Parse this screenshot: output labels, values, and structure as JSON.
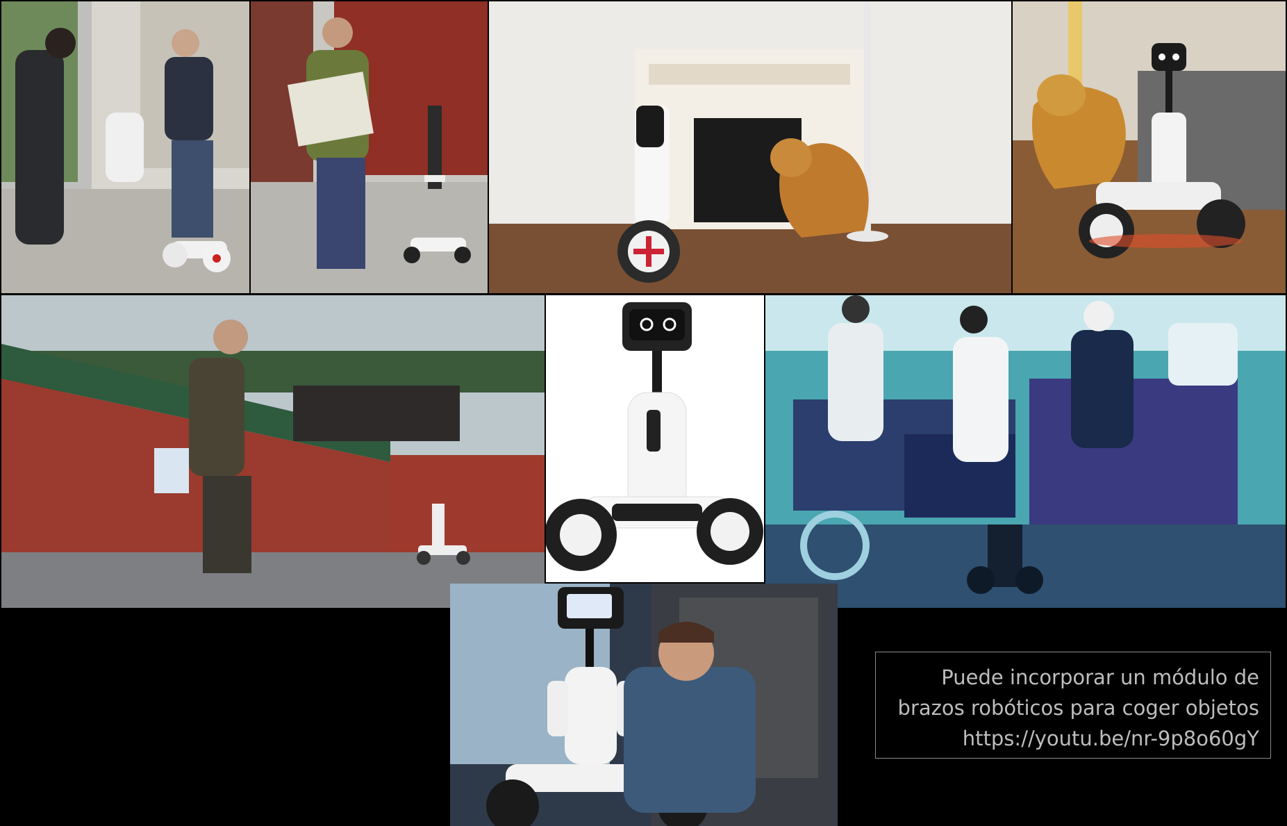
{
  "photos": [
    {
      "name": "street-photo"
    },
    {
      "name": "map-photo"
    },
    {
      "name": "fireplace-dog-photo"
    },
    {
      "name": "dog-running-photo"
    },
    {
      "name": "red-wall-photo"
    },
    {
      "name": "robot-product-photo"
    },
    {
      "name": "inverted-photo"
    },
    {
      "name": "robot-arm-photo"
    }
  ],
  "caption": {
    "line1": "Puede incorporar un módulo de",
    "line2": "brazos robóticos para coger objetos",
    "line3": "https://youtu.be/nr-9p8o60gY"
  }
}
